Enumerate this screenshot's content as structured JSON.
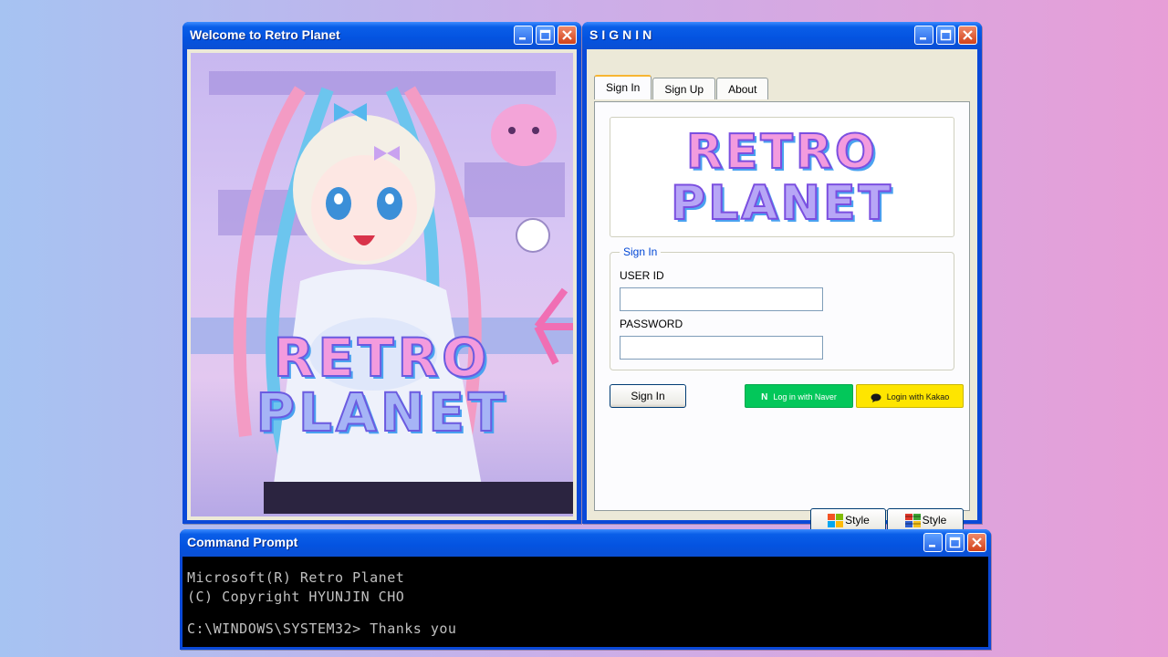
{
  "welcome_window": {
    "title": "Welcome to Retro Planet",
    "artwork_logo_line1": "RETRO",
    "artwork_logo_line2": "PLANET"
  },
  "signin_window": {
    "title": "SIGNIN",
    "tabs": [
      {
        "label": "Sign In",
        "active": true
      },
      {
        "label": "Sign Up",
        "active": false
      },
      {
        "label": "About",
        "active": false
      }
    ],
    "logo_line1": "RETRO",
    "logo_line2": "PLANET",
    "group_title": "Sign In",
    "userid_label": "USER ID",
    "userid_value": "",
    "password_label": "PASSWORD",
    "password_value": "",
    "signin_button": "Sign In",
    "naver_button": "Log in with Naver",
    "naver_icon": "N",
    "kakao_button": "Login with Kakao",
    "style_button_xp": "Style",
    "style_button_classic": "Style",
    "colors": {
      "naver": "#03c75a",
      "kakao": "#fee500",
      "accent": "#0a5ee8"
    }
  },
  "cmd_window": {
    "title": "Command Prompt",
    "lines": [
      "Microsoft(R) Retro Planet",
      "(C) Copyright HYUNJIN CHO",
      "",
      "C:\\WINDOWS\\SYSTEM32> Thanks you"
    ]
  }
}
